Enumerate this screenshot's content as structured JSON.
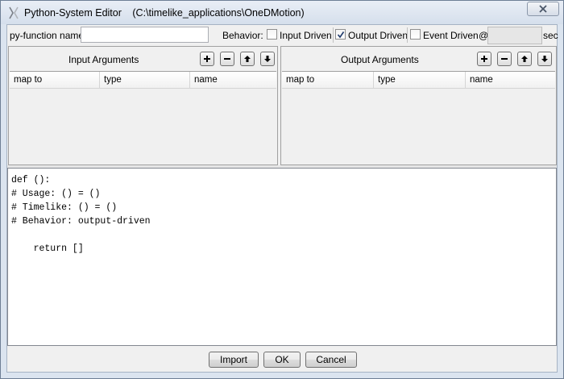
{
  "window": {
    "title": "Python-System Editor",
    "path": "(C:\\timelike_applications\\OneDMotion)",
    "close_icon": "close-icon"
  },
  "toolbar": {
    "function_name_label": "py-function name:",
    "function_name_value": "",
    "behavior_label": "Behavior:",
    "input_driven_label": "Input Driven",
    "input_driven_checked": false,
    "output_driven_label": "Output Driven",
    "output_driven_checked": true,
    "event_driven_label": "Event Driven",
    "event_driven_checked": false,
    "at_label": "@",
    "period_value": "",
    "unit_label": "sec"
  },
  "input_args": {
    "title": "Input Arguments",
    "columns": [
      "map to",
      "type",
      "name"
    ],
    "rows": []
  },
  "output_args": {
    "title": "Output Arguments",
    "columns": [
      "map to",
      "type",
      "name"
    ],
    "rows": []
  },
  "editor": {
    "code": "def ():\n# Usage: () = ()\n# Timelike: () = ()\n# Behavior: output-driven\n\n    return []"
  },
  "buttons": {
    "import_label": "Import",
    "ok_label": "OK",
    "cancel_label": "Cancel"
  }
}
